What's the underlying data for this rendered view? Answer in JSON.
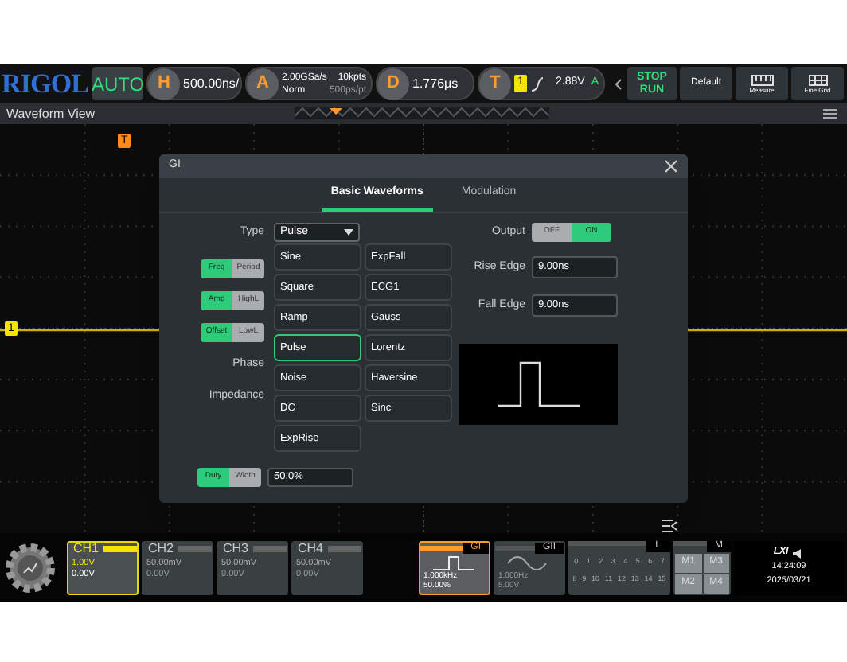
{
  "top_bar": {
    "brand": "RIGOL",
    "mode": "AUTO",
    "horizontal": {
      "letter": "H",
      "value": "500.00ns/"
    },
    "acquire": {
      "letter": "A",
      "sample_rate": "2.00GSa/s",
      "mode": "Norm",
      "depth": "10kpts",
      "resolution": "500ps/pt"
    },
    "delay": {
      "letter": "D",
      "value": "1.776μs"
    },
    "trigger": {
      "letter": "T",
      "source": "1",
      "level": "2.88V",
      "status": "A"
    },
    "run_stop": [
      "STOP",
      "RUN"
    ],
    "buttons": [
      {
        "label": "Default",
        "kind": "text"
      },
      {
        "label": "Measure",
        "kind": "ruler"
      },
      {
        "label": "Fine Grid",
        "kind": "grid"
      }
    ]
  },
  "waveform_view": {
    "title": "Waveform View",
    "channel_marker": "1",
    "trigger_marker": "T"
  },
  "dialog": {
    "title": "GI",
    "tabs": [
      {
        "label": "Basic Waveforms",
        "selected": true
      },
      {
        "label": "Modulation",
        "selected": false
      }
    ],
    "type": {
      "label": "Type",
      "value": "Pulse"
    },
    "left_rows": [
      {
        "kind": "toggle",
        "options": [
          {
            "label": "Freq",
            "selected": true
          },
          {
            "label": "Period",
            "selected": false
          }
        ]
      },
      {
        "kind": "toggle",
        "options": [
          {
            "label": "Amp",
            "selected": true
          },
          {
            "label": "HighL",
            "selected": false
          }
        ]
      },
      {
        "kind": "toggle",
        "options": [
          {
            "label": "Offset",
            "selected": true
          },
          {
            "label": "LowL",
            "selected": false
          }
        ]
      },
      {
        "kind": "label",
        "label": "Phase"
      },
      {
        "kind": "label",
        "label": "Impedance"
      }
    ],
    "waveform_options": [
      {
        "label": "Sine",
        "selected": false
      },
      {
        "label": "ExpFall",
        "selected": false
      },
      {
        "label": "Square",
        "selected": false
      },
      {
        "label": "ECG1",
        "selected": false
      },
      {
        "label": "Ramp",
        "selected": false
      },
      {
        "label": "Gauss",
        "selected": false
      },
      {
        "label": "Pulse",
        "selected": true
      },
      {
        "label": "Lorentz",
        "selected": false
      },
      {
        "label": "Noise",
        "selected": false
      },
      {
        "label": "Haversine",
        "selected": false
      },
      {
        "label": "DC",
        "selected": false
      },
      {
        "label": "Sinc",
        "selected": false
      },
      {
        "label": "ExpRise",
        "selected": false
      }
    ],
    "output": {
      "label": "Output",
      "options": [
        {
          "label": "OFF",
          "selected": false
        },
        {
          "label": "ON",
          "selected": true
        }
      ]
    },
    "fields": [
      {
        "label": "Rise Edge",
        "value": "9.00ns"
      },
      {
        "label": "Fall Edge",
        "value": "9.00ns"
      }
    ],
    "duty": {
      "options": [
        {
          "label": "Duty",
          "selected": true
        },
        {
          "label": "Width",
          "selected": false
        }
      ],
      "value": "50.0%"
    }
  },
  "bottom_bar": {
    "channels": [
      {
        "name": "CH1",
        "scale": "1.00V",
        "offset": "0.00V",
        "selected": true
      },
      {
        "name": "CH2",
        "scale": "50.00mV",
        "offset": "0.00V",
        "selected": false
      },
      {
        "name": "CH3",
        "scale": "50.00mV",
        "offset": "0.00V",
        "selected": false
      },
      {
        "name": "CH4",
        "scale": "50.00mV",
        "offset": "0.00V",
        "selected": false
      }
    ],
    "generators": [
      {
        "name": "GI",
        "kind": "pulse",
        "line1": "1.000kHz",
        "line2": "50.00%",
        "selected": true
      },
      {
        "name": "GII",
        "kind": "sine",
        "line1": "1.000Hz",
        "line2": "5.00V",
        "selected": false
      }
    ],
    "logic": {
      "name": "L",
      "rows": [
        [
          "0",
          "1",
          "2",
          "3",
          "4",
          "5",
          "6",
          "7"
        ],
        [
          "8",
          "9",
          "10",
          "11",
          "12",
          "13",
          "14",
          "15"
        ]
      ]
    },
    "math": {
      "name": "M",
      "items": [
        "M1",
        "M3",
        "M2",
        "M4"
      ]
    },
    "status": {
      "lxi": "LXI",
      "time": "14:24:09",
      "date": "2025/03/21"
    }
  }
}
